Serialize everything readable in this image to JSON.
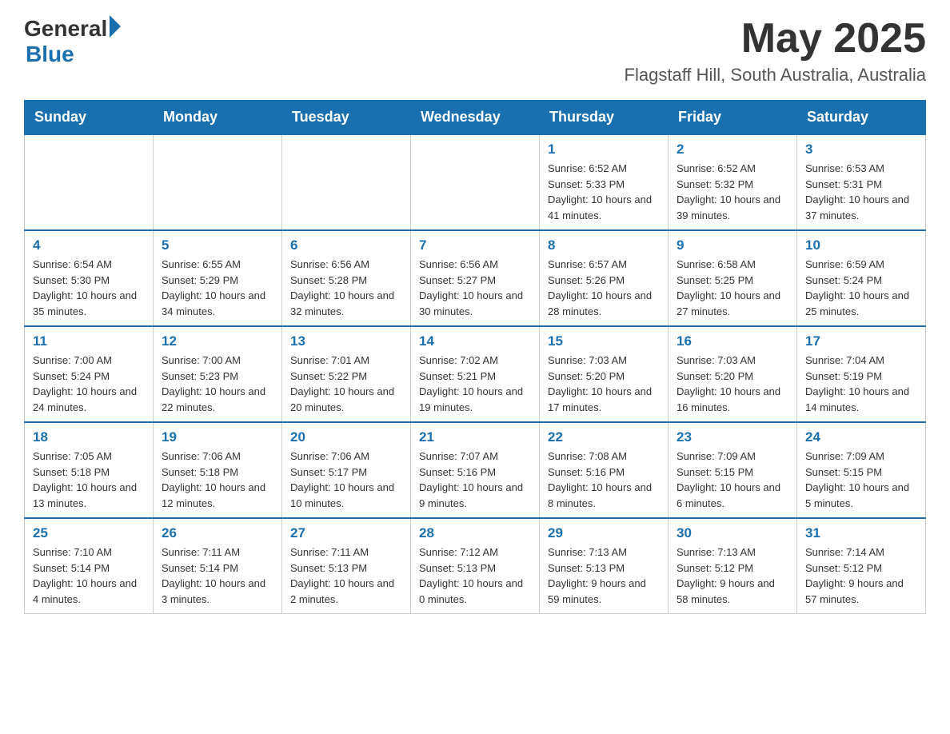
{
  "header": {
    "logo_general": "General",
    "logo_blue": "Blue",
    "month_year": "May 2025",
    "location": "Flagstaff Hill, South Australia, Australia"
  },
  "weekdays": [
    "Sunday",
    "Monday",
    "Tuesday",
    "Wednesday",
    "Thursday",
    "Friday",
    "Saturday"
  ],
  "weeks": [
    [
      {
        "day": "",
        "info": ""
      },
      {
        "day": "",
        "info": ""
      },
      {
        "day": "",
        "info": ""
      },
      {
        "day": "",
        "info": ""
      },
      {
        "day": "1",
        "info": "Sunrise: 6:52 AM\nSunset: 5:33 PM\nDaylight: 10 hours and 41 minutes."
      },
      {
        "day": "2",
        "info": "Sunrise: 6:52 AM\nSunset: 5:32 PM\nDaylight: 10 hours and 39 minutes."
      },
      {
        "day": "3",
        "info": "Sunrise: 6:53 AM\nSunset: 5:31 PM\nDaylight: 10 hours and 37 minutes."
      }
    ],
    [
      {
        "day": "4",
        "info": "Sunrise: 6:54 AM\nSunset: 5:30 PM\nDaylight: 10 hours and 35 minutes."
      },
      {
        "day": "5",
        "info": "Sunrise: 6:55 AM\nSunset: 5:29 PM\nDaylight: 10 hours and 34 minutes."
      },
      {
        "day": "6",
        "info": "Sunrise: 6:56 AM\nSunset: 5:28 PM\nDaylight: 10 hours and 32 minutes."
      },
      {
        "day": "7",
        "info": "Sunrise: 6:56 AM\nSunset: 5:27 PM\nDaylight: 10 hours and 30 minutes."
      },
      {
        "day": "8",
        "info": "Sunrise: 6:57 AM\nSunset: 5:26 PM\nDaylight: 10 hours and 28 minutes."
      },
      {
        "day": "9",
        "info": "Sunrise: 6:58 AM\nSunset: 5:25 PM\nDaylight: 10 hours and 27 minutes."
      },
      {
        "day": "10",
        "info": "Sunrise: 6:59 AM\nSunset: 5:24 PM\nDaylight: 10 hours and 25 minutes."
      }
    ],
    [
      {
        "day": "11",
        "info": "Sunrise: 7:00 AM\nSunset: 5:24 PM\nDaylight: 10 hours and 24 minutes."
      },
      {
        "day": "12",
        "info": "Sunrise: 7:00 AM\nSunset: 5:23 PM\nDaylight: 10 hours and 22 minutes."
      },
      {
        "day": "13",
        "info": "Sunrise: 7:01 AM\nSunset: 5:22 PM\nDaylight: 10 hours and 20 minutes."
      },
      {
        "day": "14",
        "info": "Sunrise: 7:02 AM\nSunset: 5:21 PM\nDaylight: 10 hours and 19 minutes."
      },
      {
        "day": "15",
        "info": "Sunrise: 7:03 AM\nSunset: 5:20 PM\nDaylight: 10 hours and 17 minutes."
      },
      {
        "day": "16",
        "info": "Sunrise: 7:03 AM\nSunset: 5:20 PM\nDaylight: 10 hours and 16 minutes."
      },
      {
        "day": "17",
        "info": "Sunrise: 7:04 AM\nSunset: 5:19 PM\nDaylight: 10 hours and 14 minutes."
      }
    ],
    [
      {
        "day": "18",
        "info": "Sunrise: 7:05 AM\nSunset: 5:18 PM\nDaylight: 10 hours and 13 minutes."
      },
      {
        "day": "19",
        "info": "Sunrise: 7:06 AM\nSunset: 5:18 PM\nDaylight: 10 hours and 12 minutes."
      },
      {
        "day": "20",
        "info": "Sunrise: 7:06 AM\nSunset: 5:17 PM\nDaylight: 10 hours and 10 minutes."
      },
      {
        "day": "21",
        "info": "Sunrise: 7:07 AM\nSunset: 5:16 PM\nDaylight: 10 hours and 9 minutes."
      },
      {
        "day": "22",
        "info": "Sunrise: 7:08 AM\nSunset: 5:16 PM\nDaylight: 10 hours and 8 minutes."
      },
      {
        "day": "23",
        "info": "Sunrise: 7:09 AM\nSunset: 5:15 PM\nDaylight: 10 hours and 6 minutes."
      },
      {
        "day": "24",
        "info": "Sunrise: 7:09 AM\nSunset: 5:15 PM\nDaylight: 10 hours and 5 minutes."
      }
    ],
    [
      {
        "day": "25",
        "info": "Sunrise: 7:10 AM\nSunset: 5:14 PM\nDaylight: 10 hours and 4 minutes."
      },
      {
        "day": "26",
        "info": "Sunrise: 7:11 AM\nSunset: 5:14 PM\nDaylight: 10 hours and 3 minutes."
      },
      {
        "day": "27",
        "info": "Sunrise: 7:11 AM\nSunset: 5:13 PM\nDaylight: 10 hours and 2 minutes."
      },
      {
        "day": "28",
        "info": "Sunrise: 7:12 AM\nSunset: 5:13 PM\nDaylight: 10 hours and 0 minutes."
      },
      {
        "day": "29",
        "info": "Sunrise: 7:13 AM\nSunset: 5:13 PM\nDaylight: 9 hours and 59 minutes."
      },
      {
        "day": "30",
        "info": "Sunrise: 7:13 AM\nSunset: 5:12 PM\nDaylight: 9 hours and 58 minutes."
      },
      {
        "day": "31",
        "info": "Sunrise: 7:14 AM\nSunset: 5:12 PM\nDaylight: 9 hours and 57 minutes."
      }
    ]
  ]
}
